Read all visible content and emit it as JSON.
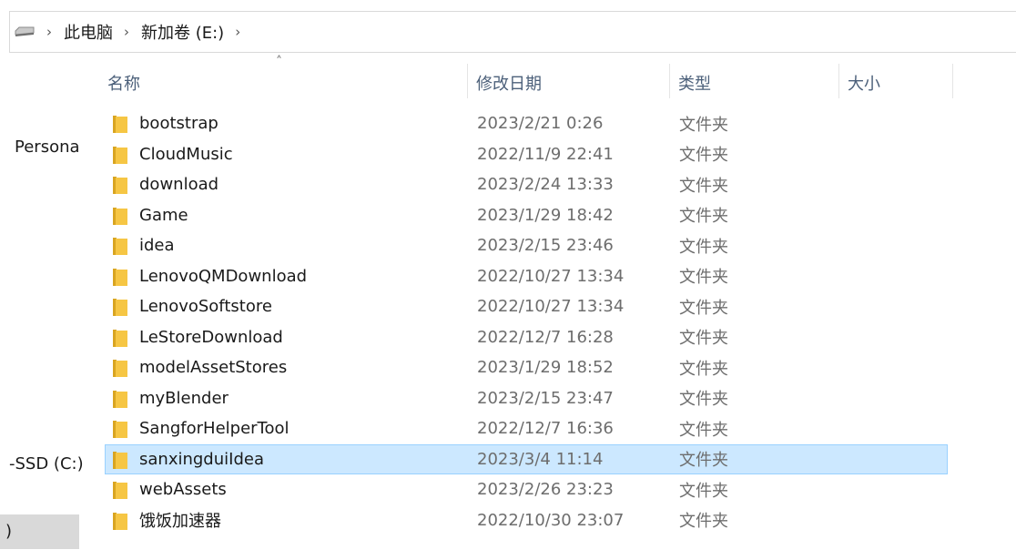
{
  "breadcrumb": {
    "drive_icon": "drive-icon",
    "items": [
      "此电脑",
      "新加卷 (E:)"
    ],
    "separator": ">"
  },
  "nav": {
    "personal_label": "Persona",
    "ssd_label": "-SSD (C:)",
    "selected_fragment": ")"
  },
  "columns": {
    "name": "名称",
    "date": "修改日期",
    "type": "类型",
    "size": "大小",
    "sort_indicator": "^"
  },
  "files": [
    {
      "name": "bootstrap",
      "date": "2023/2/21 0:26",
      "type": "文件夹",
      "selected": false
    },
    {
      "name": "CloudMusic",
      "date": "2022/11/9 22:41",
      "type": "文件夹",
      "selected": false
    },
    {
      "name": "download",
      "date": "2023/2/24 13:33",
      "type": "文件夹",
      "selected": false
    },
    {
      "name": "Game",
      "date": "2023/1/29 18:42",
      "type": "文件夹",
      "selected": false
    },
    {
      "name": "idea",
      "date": "2023/2/15 23:46",
      "type": "文件夹",
      "selected": false
    },
    {
      "name": "LenovoQMDownload",
      "date": "2022/10/27 13:34",
      "type": "文件夹",
      "selected": false
    },
    {
      "name": "LenovoSoftstore",
      "date": "2022/10/27 13:34",
      "type": "文件夹",
      "selected": false
    },
    {
      "name": "LeStoreDownload",
      "date": "2022/12/7 16:28",
      "type": "文件夹",
      "selected": false
    },
    {
      "name": "modelAssetStores",
      "date": "2023/1/29 18:52",
      "type": "文件夹",
      "selected": false
    },
    {
      "name": "myBlender",
      "date": "2023/2/15 23:47",
      "type": "文件夹",
      "selected": false
    },
    {
      "name": "SangforHelperTool",
      "date": "2022/12/7 16:36",
      "type": "文件夹",
      "selected": false
    },
    {
      "name": "sanxingduiIdea",
      "date": "2023/3/4 11:14",
      "type": "文件夹",
      "selected": true
    },
    {
      "name": "webAssets",
      "date": "2023/2/26 23:23",
      "type": "文件夹",
      "selected": false
    },
    {
      "name": "饿饭加速器",
      "date": "2022/10/30 23:07",
      "type": "文件夹",
      "selected": false
    }
  ],
  "colors": {
    "folder": "#f6c644",
    "selection": "#cce8ff",
    "selection_border": "#99d1ff",
    "header_text": "#4c607a"
  }
}
